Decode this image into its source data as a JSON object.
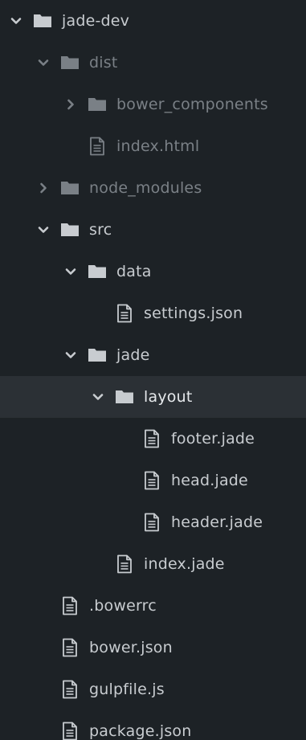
{
  "colors": {
    "background": "#1d2226",
    "selected_row": "#2b3035",
    "text": "#c8ccd0",
    "text_dim": "#7a8086",
    "icon": "#c8ccd0",
    "icon_dim": "#7a8086"
  },
  "tree": [
    {
      "label": "jade-dev",
      "type": "folder",
      "expanded": true,
      "depth": 0,
      "dim": false
    },
    {
      "label": "dist",
      "type": "folder",
      "expanded": true,
      "depth": 1,
      "dim": true
    },
    {
      "label": "bower_components",
      "type": "folder",
      "expanded": false,
      "depth": 2,
      "dim": true
    },
    {
      "label": "index.html",
      "type": "file",
      "depth": 2,
      "dim": true
    },
    {
      "label": "node_modules",
      "type": "folder",
      "expanded": false,
      "depth": 1,
      "dim": true
    },
    {
      "label": "src",
      "type": "folder",
      "expanded": true,
      "depth": 1,
      "dim": false
    },
    {
      "label": "data",
      "type": "folder",
      "expanded": true,
      "depth": 2,
      "dim": false
    },
    {
      "label": "settings.json",
      "type": "file",
      "depth": 3,
      "dim": false
    },
    {
      "label": "jade",
      "type": "folder",
      "expanded": true,
      "depth": 2,
      "dim": false
    },
    {
      "label": "layout",
      "type": "folder",
      "expanded": true,
      "depth": 3,
      "dim": false,
      "selected": true
    },
    {
      "label": "footer.jade",
      "type": "file",
      "depth": 4,
      "dim": false
    },
    {
      "label": "head.jade",
      "type": "file",
      "depth": 4,
      "dim": false
    },
    {
      "label": "header.jade",
      "type": "file",
      "depth": 4,
      "dim": false
    },
    {
      "label": "index.jade",
      "type": "file",
      "depth": 3,
      "dim": false
    },
    {
      "label": ".bowerrc",
      "type": "file",
      "depth": 1,
      "dim": false
    },
    {
      "label": "bower.json",
      "type": "file",
      "depth": 1,
      "dim": false
    },
    {
      "label": "gulpfile.js",
      "type": "file",
      "depth": 1,
      "dim": false
    },
    {
      "label": "package.json",
      "type": "file",
      "depth": 1,
      "dim": false
    }
  ]
}
